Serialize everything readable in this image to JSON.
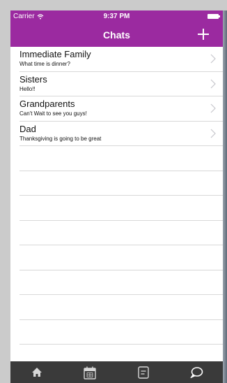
{
  "status_bar": {
    "carrier": "Carrier",
    "time": "9:37 PM"
  },
  "nav_bar": {
    "title": "Chats",
    "add_icon": "plus-icon"
  },
  "colors": {
    "accent": "#9b2aa0",
    "tab_bar": "#3a3a3a",
    "separator": "#d8d8d8"
  },
  "chats": [
    {
      "name": "Immediate Family",
      "preview": "What time is dinner?"
    },
    {
      "name": "Sisters",
      "preview": "Hello!!"
    },
    {
      "name": "Grandparents",
      "preview": "Can't Wait to see you guys!"
    },
    {
      "name": "Dad",
      "preview": "Thanksgiving is going to be great"
    }
  ],
  "tab_bar": {
    "tabs": [
      {
        "icon": "home-icon"
      },
      {
        "icon": "calendar-icon"
      },
      {
        "icon": "notes-icon"
      },
      {
        "icon": "chat-bubble-icon"
      }
    ]
  }
}
